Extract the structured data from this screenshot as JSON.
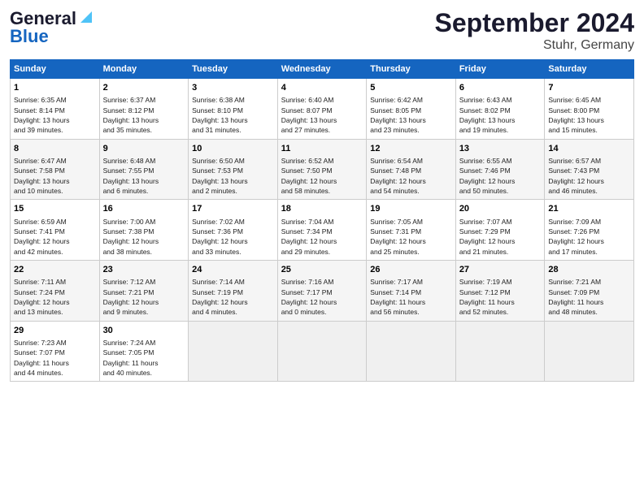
{
  "header": {
    "logo_line1": "General",
    "logo_line2": "Blue",
    "title": "September 2024",
    "subtitle": "Stuhr, Germany"
  },
  "columns": [
    "Sunday",
    "Monday",
    "Tuesday",
    "Wednesday",
    "Thursday",
    "Friday",
    "Saturday"
  ],
  "weeks": [
    [
      {
        "day": "1",
        "info": "Sunrise: 6:35 AM\nSunset: 8:14 PM\nDaylight: 13 hours\nand 39 minutes."
      },
      {
        "day": "2",
        "info": "Sunrise: 6:37 AM\nSunset: 8:12 PM\nDaylight: 13 hours\nand 35 minutes."
      },
      {
        "day": "3",
        "info": "Sunrise: 6:38 AM\nSunset: 8:10 PM\nDaylight: 13 hours\nand 31 minutes."
      },
      {
        "day": "4",
        "info": "Sunrise: 6:40 AM\nSunset: 8:07 PM\nDaylight: 13 hours\nand 27 minutes."
      },
      {
        "day": "5",
        "info": "Sunrise: 6:42 AM\nSunset: 8:05 PM\nDaylight: 13 hours\nand 23 minutes."
      },
      {
        "day": "6",
        "info": "Sunrise: 6:43 AM\nSunset: 8:02 PM\nDaylight: 13 hours\nand 19 minutes."
      },
      {
        "day": "7",
        "info": "Sunrise: 6:45 AM\nSunset: 8:00 PM\nDaylight: 13 hours\nand 15 minutes."
      }
    ],
    [
      {
        "day": "8",
        "info": "Sunrise: 6:47 AM\nSunset: 7:58 PM\nDaylight: 13 hours\nand 10 minutes."
      },
      {
        "day": "9",
        "info": "Sunrise: 6:48 AM\nSunset: 7:55 PM\nDaylight: 13 hours\nand 6 minutes."
      },
      {
        "day": "10",
        "info": "Sunrise: 6:50 AM\nSunset: 7:53 PM\nDaylight: 13 hours\nand 2 minutes."
      },
      {
        "day": "11",
        "info": "Sunrise: 6:52 AM\nSunset: 7:50 PM\nDaylight: 12 hours\nand 58 minutes."
      },
      {
        "day": "12",
        "info": "Sunrise: 6:54 AM\nSunset: 7:48 PM\nDaylight: 12 hours\nand 54 minutes."
      },
      {
        "day": "13",
        "info": "Sunrise: 6:55 AM\nSunset: 7:46 PM\nDaylight: 12 hours\nand 50 minutes."
      },
      {
        "day": "14",
        "info": "Sunrise: 6:57 AM\nSunset: 7:43 PM\nDaylight: 12 hours\nand 46 minutes."
      }
    ],
    [
      {
        "day": "15",
        "info": "Sunrise: 6:59 AM\nSunset: 7:41 PM\nDaylight: 12 hours\nand 42 minutes."
      },
      {
        "day": "16",
        "info": "Sunrise: 7:00 AM\nSunset: 7:38 PM\nDaylight: 12 hours\nand 38 minutes."
      },
      {
        "day": "17",
        "info": "Sunrise: 7:02 AM\nSunset: 7:36 PM\nDaylight: 12 hours\nand 33 minutes."
      },
      {
        "day": "18",
        "info": "Sunrise: 7:04 AM\nSunset: 7:34 PM\nDaylight: 12 hours\nand 29 minutes."
      },
      {
        "day": "19",
        "info": "Sunrise: 7:05 AM\nSunset: 7:31 PM\nDaylight: 12 hours\nand 25 minutes."
      },
      {
        "day": "20",
        "info": "Sunrise: 7:07 AM\nSunset: 7:29 PM\nDaylight: 12 hours\nand 21 minutes."
      },
      {
        "day": "21",
        "info": "Sunrise: 7:09 AM\nSunset: 7:26 PM\nDaylight: 12 hours\nand 17 minutes."
      }
    ],
    [
      {
        "day": "22",
        "info": "Sunrise: 7:11 AM\nSunset: 7:24 PM\nDaylight: 12 hours\nand 13 minutes."
      },
      {
        "day": "23",
        "info": "Sunrise: 7:12 AM\nSunset: 7:21 PM\nDaylight: 12 hours\nand 9 minutes."
      },
      {
        "day": "24",
        "info": "Sunrise: 7:14 AM\nSunset: 7:19 PM\nDaylight: 12 hours\nand 4 minutes."
      },
      {
        "day": "25",
        "info": "Sunrise: 7:16 AM\nSunset: 7:17 PM\nDaylight: 12 hours\nand 0 minutes."
      },
      {
        "day": "26",
        "info": "Sunrise: 7:17 AM\nSunset: 7:14 PM\nDaylight: 11 hours\nand 56 minutes."
      },
      {
        "day": "27",
        "info": "Sunrise: 7:19 AM\nSunset: 7:12 PM\nDaylight: 11 hours\nand 52 minutes."
      },
      {
        "day": "28",
        "info": "Sunrise: 7:21 AM\nSunset: 7:09 PM\nDaylight: 11 hours\nand 48 minutes."
      }
    ],
    [
      {
        "day": "29",
        "info": "Sunrise: 7:23 AM\nSunset: 7:07 PM\nDaylight: 11 hours\nand 44 minutes."
      },
      {
        "day": "30",
        "info": "Sunrise: 7:24 AM\nSunset: 7:05 PM\nDaylight: 11 hours\nand 40 minutes."
      },
      {
        "day": "",
        "info": ""
      },
      {
        "day": "",
        "info": ""
      },
      {
        "day": "",
        "info": ""
      },
      {
        "day": "",
        "info": ""
      },
      {
        "day": "",
        "info": ""
      }
    ]
  ]
}
